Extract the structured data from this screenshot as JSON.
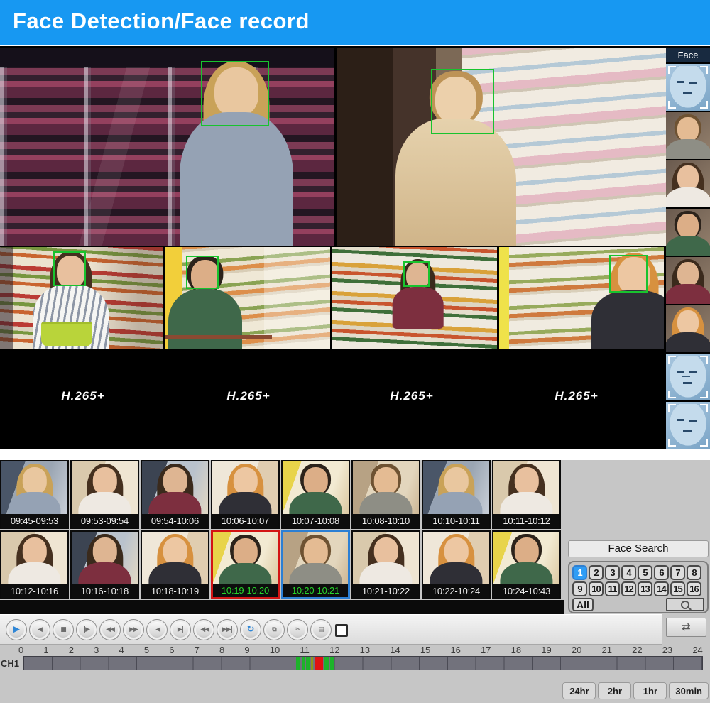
{
  "banner": {
    "title": "Face Detection/Face record",
    "bg": "#1798f2"
  },
  "monitor": {
    "codec_labels": [
      "H.265+",
      "H.265+",
      "H.265+",
      "H.265+"
    ],
    "face_box_color": "#18c32e",
    "views": [
      "freezer-aisle-man",
      "dairy-shelf-man",
      "basket-woman",
      "cart-man",
      "shelf-woman",
      "blonde-woman"
    ]
  },
  "sidebar": {
    "title": "Face",
    "thumbs": [
      {
        "type": "scan"
      },
      {
        "type": "p-curly-man"
      },
      {
        "type": "p-brunette"
      },
      {
        "type": "p-green-man"
      },
      {
        "type": "p-darkred-woman"
      },
      {
        "type": "p-redhead"
      },
      {
        "type": "scan"
      },
      {
        "type": "scan"
      }
    ]
  },
  "grid": {
    "items": [
      {
        "time": "09:45-09:53",
        "person": "p-blond-man",
        "sel": ""
      },
      {
        "time": "09:53-09:54",
        "person": "p-brunette",
        "sel": ""
      },
      {
        "time": "09:54-10:06",
        "person": "p-darkred-woman",
        "sel": ""
      },
      {
        "time": "10:06-10:07",
        "person": "p-redhead",
        "sel": ""
      },
      {
        "time": "10:07-10:08",
        "person": "p-green-man",
        "sel": ""
      },
      {
        "time": "10:08-10:10",
        "person": "p-curly-man",
        "sel": ""
      },
      {
        "time": "10:10-10:11",
        "person": "p-blond-man",
        "sel": ""
      },
      {
        "time": "10:11-10:12",
        "person": "p-brunette",
        "sel": ""
      },
      {
        "time": "10:12-10:16",
        "person": "p-brunette",
        "sel": ""
      },
      {
        "time": "10:16-10:18",
        "person": "p-darkred-woman",
        "sel": ""
      },
      {
        "time": "10:18-10:19",
        "person": "p-redhead",
        "sel": ""
      },
      {
        "time": "10:19-10:20",
        "person": "p-green-man",
        "sel": "sel-red"
      },
      {
        "time": "10:20-10:21",
        "person": "p-curly-man",
        "sel": "sel-blue"
      },
      {
        "time": "10:21-10:22",
        "person": "p-brunette",
        "sel": ""
      },
      {
        "time": "10:22-10:24",
        "person": "p-redhead",
        "sel": ""
      },
      {
        "time": "10:24-10:43",
        "person": "p-green-man",
        "sel": ""
      }
    ],
    "selected_time_color": "#27d42b",
    "selection_border_red": "#d31414",
    "selection_border_blue": "#2b7fd4"
  },
  "face_search": {
    "title": "Face Search",
    "all_label": "All",
    "channels": [
      {
        "label": "1",
        "state": "active"
      },
      {
        "label": "2",
        "state": ""
      },
      {
        "label": "3",
        "state": ""
      },
      {
        "label": "4",
        "state": ""
      },
      {
        "label": "5",
        "state": ""
      },
      {
        "label": "6",
        "state": ""
      },
      {
        "label": "7",
        "state": ""
      },
      {
        "label": "8",
        "state": ""
      },
      {
        "label": "9",
        "state": ""
      },
      {
        "label": "10",
        "state": ""
      },
      {
        "label": "11",
        "state": ""
      },
      {
        "label": "12",
        "state": ""
      },
      {
        "label": "13",
        "state": ""
      },
      {
        "label": "14",
        "state": ""
      },
      {
        "label": "15",
        "state": ""
      },
      {
        "label": "16",
        "state": ""
      }
    ],
    "active_color": "#2f9df5"
  },
  "controls": [
    {
      "name": "play",
      "glyph": "▶",
      "cls": "accent"
    },
    {
      "name": "reverse-play",
      "glyph": "◀",
      "cls": ""
    },
    {
      "name": "stop",
      "glyph": "■",
      "cls": ""
    },
    {
      "name": "step-forward",
      "glyph": "|▶",
      "cls": ""
    },
    {
      "name": "rewind",
      "glyph": "◀◀",
      "cls": ""
    },
    {
      "name": "fast-forward",
      "glyph": "▶▶",
      "cls": ""
    },
    {
      "name": "prev-frame",
      "glyph": "|◀",
      "cls": ""
    },
    {
      "name": "next-frame",
      "glyph": "▶|",
      "cls": ""
    },
    {
      "name": "first-record",
      "glyph": "|◀◀",
      "cls": ""
    },
    {
      "name": "last-record",
      "glyph": "▶▶|",
      "cls": ""
    },
    {
      "name": "loop",
      "glyph": "↻",
      "cls": "accent"
    },
    {
      "name": "copy",
      "glyph": "⧉",
      "cls": ""
    },
    {
      "name": "cut",
      "glyph": "✂",
      "cls": ""
    },
    {
      "name": "save",
      "glyph": "▤",
      "cls": ""
    }
  ],
  "refresh": {
    "glyph": "⇄"
  },
  "timeline": {
    "channel": "CH1",
    "hours": [
      0,
      1,
      2,
      3,
      4,
      5,
      6,
      7,
      8,
      9,
      10,
      11,
      12,
      13,
      14,
      15,
      16,
      17,
      18,
      19,
      20,
      21,
      22,
      23,
      24
    ],
    "segments": [
      {
        "start": 9.62,
        "end": 9.78,
        "color": "#1db32a"
      },
      {
        "start": 9.82,
        "end": 9.94,
        "color": "#1db32a"
      },
      {
        "start": 9.98,
        "end": 10.12,
        "color": "#1db32a"
      },
      {
        "start": 10.16,
        "end": 10.24,
        "color": "#8a9a1a"
      },
      {
        "start": 10.28,
        "end": 10.58,
        "color": "#e01212"
      },
      {
        "start": 10.62,
        "end": 10.7,
        "color": "#1db32a"
      },
      {
        "start": 10.74,
        "end": 10.8,
        "color": "#1db32a"
      },
      {
        "start": 10.84,
        "end": 10.96,
        "color": "#1db32a"
      }
    ]
  },
  "range_buttons": [
    "24hr",
    "2hr",
    "1hr",
    "30min"
  ]
}
